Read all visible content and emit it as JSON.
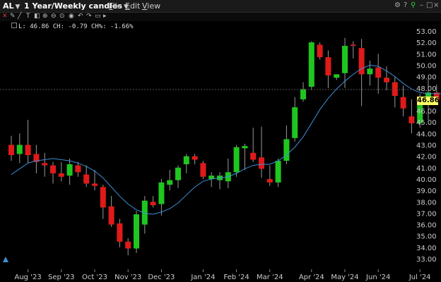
{
  "header": {
    "symbol": "AL",
    "period": "1 Year/Weekly candles",
    "menus": [
      {
        "label": "File",
        "u": "F",
        "rest": "ile"
      },
      {
        "label": "Edit",
        "u": "E",
        "rest": "dit"
      },
      {
        "label": "View",
        "u": "V",
        "rest": "iew"
      }
    ],
    "window_icons": [
      "settings-icon",
      "help-icon",
      "link-icon",
      "minimize-icon",
      "maximize-icon",
      "close-icon"
    ]
  },
  "toolbar_icons": [
    "crosshair-icon",
    "pencil-icon",
    "line-tool-icon",
    "text-tool-icon",
    "eraser-icon",
    "zoom-in-icon",
    "zoom-out-icon",
    "target-icon",
    "magnet-icon",
    "undo-icon",
    "redo-icon",
    "ruler-icon",
    "expand-icon"
  ],
  "readout": {
    "text": "L: 46.86 CH: -0.79 CH%: -1.66%"
  },
  "last_price": "46.86",
  "colors": {
    "up": "#1fc61f",
    "down": "#e01a1a",
    "ma": "#3d8fd6",
    "background": "#000000",
    "grid_label": "#cccccc",
    "price_tag": "#ffff66"
  },
  "chart_data": {
    "type": "candlestick",
    "ylim": [
      32.5,
      53.5
    ],
    "y_ticks": [
      "53.00",
      "52.00",
      "51.00",
      "50.00",
      "49.00",
      "48.00",
      "47.00",
      "46.00",
      "45.00",
      "44.00",
      "43.00",
      "42.00",
      "41.00",
      "40.00",
      "39.00",
      "38.00",
      "37.00",
      "36.00",
      "35.00",
      "34.00",
      "33.00"
    ],
    "x_ticks": [
      "Aug '23",
      "Sep '23",
      "Oct '23",
      "Nov '23",
      "Dec '23",
      "Jan '24",
      "Feb '24",
      "Mar '24",
      "Apr '24",
      "May '24",
      "Jun '24",
      "Jul '24"
    ],
    "x_tick_candle_index": [
      2,
      6,
      10,
      14,
      18,
      23,
      27,
      31,
      36,
      40,
      44,
      49
    ],
    "candles": [
      {
        "o": 43.0,
        "h": 43.8,
        "l": 41.6,
        "c": 42.1
      },
      {
        "o": 42.2,
        "h": 44.0,
        "l": 41.4,
        "c": 43.0
      },
      {
        "o": 43.0,
        "h": 45.2,
        "l": 41.4,
        "c": 42.1
      },
      {
        "o": 42.2,
        "h": 43.0,
        "l": 40.5,
        "c": 41.5
      },
      {
        "o": 41.4,
        "h": 42.3,
        "l": 40.2,
        "c": 41.2
      },
      {
        "o": 41.2,
        "h": 41.5,
        "l": 39.6,
        "c": 40.5
      },
      {
        "o": 40.5,
        "h": 41.5,
        "l": 39.8,
        "c": 40.2
      },
      {
        "o": 40.3,
        "h": 41.8,
        "l": 39.5,
        "c": 41.3
      },
      {
        "o": 41.2,
        "h": 41.5,
        "l": 40.2,
        "c": 40.6
      },
      {
        "o": 40.4,
        "h": 41.2,
        "l": 39.3,
        "c": 39.6
      },
      {
        "o": 39.6,
        "h": 40.8,
        "l": 39.0,
        "c": 39.4
      },
      {
        "o": 39.3,
        "h": 39.5,
        "l": 36.5,
        "c": 37.5
      },
      {
        "o": 37.6,
        "h": 38.5,
        "l": 35.8,
        "c": 36.0
      },
      {
        "o": 36.1,
        "h": 36.5,
        "l": 34.0,
        "c": 34.5
      },
      {
        "o": 34.5,
        "h": 34.8,
        "l": 33.3,
        "c": 33.9
      },
      {
        "o": 33.9,
        "h": 37.2,
        "l": 33.5,
        "c": 36.9
      },
      {
        "o": 36.0,
        "h": 38.5,
        "l": 35.2,
        "c": 38.1
      },
      {
        "o": 38.0,
        "h": 38.5,
        "l": 37.5,
        "c": 37.7
      },
      {
        "o": 37.8,
        "h": 40.0,
        "l": 36.8,
        "c": 39.7
      },
      {
        "o": 39.5,
        "h": 40.8,
        "l": 39.0,
        "c": 39.9
      },
      {
        "o": 39.9,
        "h": 41.2,
        "l": 39.2,
        "c": 41.0
      },
      {
        "o": 41.3,
        "h": 42.2,
        "l": 40.5,
        "c": 42.0
      },
      {
        "o": 42.0,
        "h": 42.2,
        "l": 41.3,
        "c": 41.7
      },
      {
        "o": 41.4,
        "h": 41.6,
        "l": 40.0,
        "c": 40.2
      },
      {
        "o": 40.0,
        "h": 40.6,
        "l": 39.3,
        "c": 40.3
      },
      {
        "o": 39.9,
        "h": 40.6,
        "l": 39.1,
        "c": 40.3
      },
      {
        "o": 39.8,
        "h": 41.8,
        "l": 39.2,
        "c": 40.6
      },
      {
        "o": 40.6,
        "h": 43.0,
        "l": 40.2,
        "c": 42.8
      },
      {
        "o": 42.7,
        "h": 43.1,
        "l": 40.8,
        "c": 42.9
      },
      {
        "o": 42.3,
        "h": 44.5,
        "l": 41.5,
        "c": 41.7
      },
      {
        "o": 41.9,
        "h": 44.6,
        "l": 40.1,
        "c": 40.9
      },
      {
        "o": 40.0,
        "h": 41.2,
        "l": 39.4,
        "c": 39.7
      },
      {
        "o": 39.7,
        "h": 41.8,
        "l": 39.3,
        "c": 41.6
      },
      {
        "o": 41.6,
        "h": 44.7,
        "l": 41.3,
        "c": 43.5
      },
      {
        "o": 43.6,
        "h": 47.2,
        "l": 43.3,
        "c": 46.3
      },
      {
        "o": 47.0,
        "h": 48.5,
        "l": 46.8,
        "c": 47.9
      },
      {
        "o": 48.1,
        "h": 52.1,
        "l": 47.8,
        "c": 52.0
      },
      {
        "o": 51.8,
        "h": 52.0,
        "l": 50.5,
        "c": 50.7
      },
      {
        "o": 50.7,
        "h": 51.3,
        "l": 48.0,
        "c": 49.1
      },
      {
        "o": 48.9,
        "h": 49.2,
        "l": 48.7,
        "c": 49.2
      },
      {
        "o": 49.3,
        "h": 52.4,
        "l": 48.0,
        "c": 51.7
      },
      {
        "o": 51.8,
        "h": 52.1,
        "l": 50.6,
        "c": 51.7
      },
      {
        "o": 51.5,
        "h": 52.3,
        "l": 46.4,
        "c": 49.2
      },
      {
        "o": 49.2,
        "h": 50.4,
        "l": 48.2,
        "c": 49.7
      },
      {
        "o": 49.8,
        "h": 51.0,
        "l": 47.5,
        "c": 48.9
      },
      {
        "o": 48.9,
        "h": 49.9,
        "l": 47.8,
        "c": 48.5
      },
      {
        "o": 48.5,
        "h": 49.0,
        "l": 46.3,
        "c": 47.3
      },
      {
        "o": 47.2,
        "h": 48.2,
        "l": 45.5,
        "c": 46.2
      },
      {
        "o": 45.5,
        "h": 47.0,
        "l": 44.0,
        "c": 44.9
      },
      {
        "o": 44.9,
        "h": 47.5,
        "l": 44.5,
        "c": 47.0
      },
      {
        "o": 47.1,
        "h": 48.8,
        "l": 45.2,
        "c": 47.6
      },
      {
        "o": 47.6,
        "h": 48.3,
        "l": 46.8,
        "c": 46.9
      },
      {
        "o": 47.8,
        "h": 48.1,
        "l": 46.6,
        "c": 46.9
      }
    ],
    "moving_average": [
      40.4,
      40.9,
      41.4,
      41.6,
      41.7,
      41.8,
      41.7,
      41.6,
      41.4,
      41.1,
      40.7,
      40.1,
      39.3,
      38.5,
      37.8,
      37.3,
      37.0,
      36.9,
      37.1,
      37.4,
      37.9,
      38.6,
      39.3,
      39.8,
      40.0,
      40.1,
      40.2,
      40.5,
      40.9,
      41.2,
      41.3,
      41.3,
      41.6,
      42.1,
      42.8,
      43.7,
      44.9,
      46.1,
      47.1,
      47.9,
      48.6,
      49.2,
      49.7,
      50.0,
      49.9,
      49.5,
      49.0,
      48.4,
      47.9,
      47.6,
      47.5,
      47.5,
      47.5
    ]
  }
}
